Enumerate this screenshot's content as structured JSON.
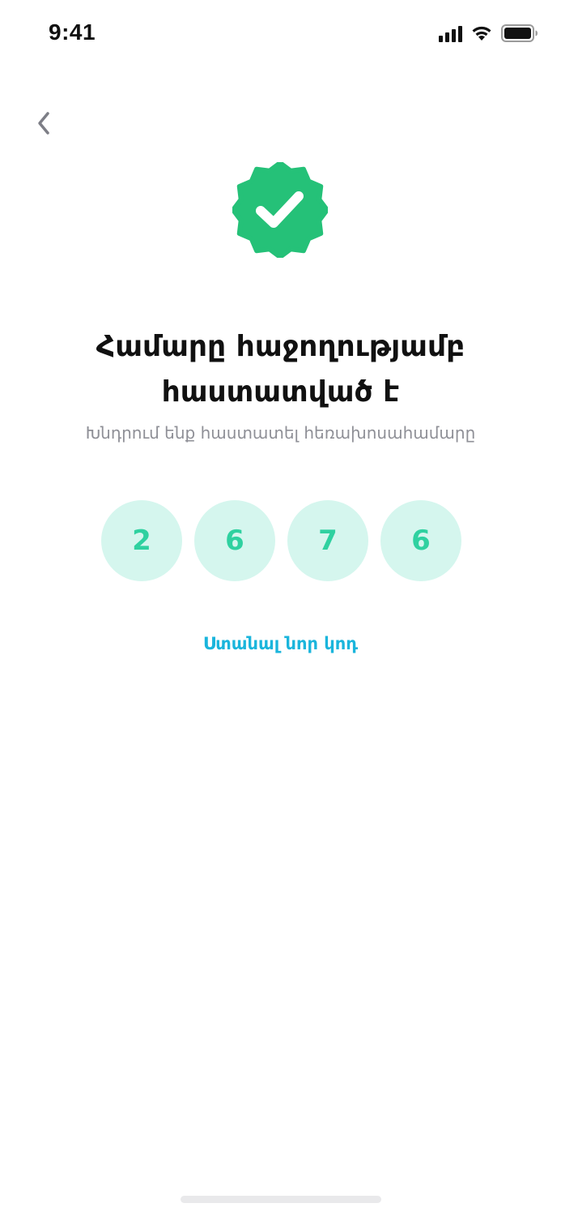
{
  "status_bar": {
    "time": "9:41",
    "icons": [
      "signal-icon",
      "wifi-icon",
      "battery-icon"
    ]
  },
  "nav": {
    "back_icon": "chevron-left-icon"
  },
  "badge": {
    "icon": "verified-check-badge-icon",
    "color": "#25c178"
  },
  "title": {
    "line1": "Համարը հաջողությամբ",
    "line2": "հաստատված է"
  },
  "subtitle": "Խնդրում ենք հաստատել հեռախոսահամարը",
  "code": [
    "2",
    "6",
    "7",
    "6"
  ],
  "resend_link": "Ստանալ նոր կոդ",
  "colors": {
    "accent": "#25c178",
    "digit_bg": "#d5f6ee",
    "digit_text": "#2fd1a0",
    "link": "#1ab5dc"
  }
}
